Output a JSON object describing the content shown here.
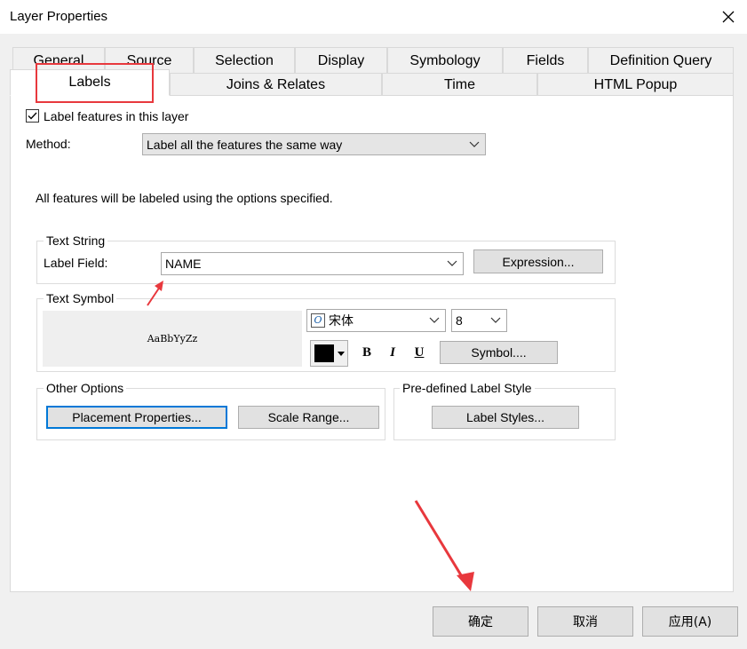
{
  "window": {
    "title": "Layer Properties"
  },
  "tabs_row1": [
    "General",
    "Source",
    "Selection",
    "Display",
    "Symbology",
    "Fields",
    "Definition Query"
  ],
  "tabs_row2": [
    "Labels",
    "Joins & Relates",
    "Time",
    "HTML Popup"
  ],
  "active_tab": "Labels",
  "labels_tab": {
    "label_features_checkbox": "Label features in this layer",
    "label_features_checked": true,
    "method_label": "Method:",
    "method_value": "Label all the features the same way",
    "info_text": "All features will be labeled using the options specified.",
    "text_string": {
      "title": "Text String",
      "label_field_label": "Label Field:",
      "label_field_value": "NAME",
      "expression_button": "Expression..."
    },
    "text_symbol": {
      "title": "Text Symbol",
      "preview_text": "AaBbYyZz",
      "font_value": "宋体",
      "size_value": "8",
      "bold": "B",
      "italic": "I",
      "underline": "U",
      "symbol_button": "Symbol...."
    },
    "other_options": {
      "title": "Other Options",
      "placement_button": "Placement Properties...",
      "scale_button": "Scale Range..."
    },
    "predefined_style": {
      "title": "Pre-defined Label Style",
      "label_styles_button": "Label Styles..."
    }
  },
  "footer": {
    "ok_button": "确定",
    "cancel_button": "取消",
    "apply_button": "应用(A)"
  },
  "colors": {
    "highlight_box": "#e8383d",
    "arrow": "#e8383d",
    "focus_border": "#0078d7"
  }
}
